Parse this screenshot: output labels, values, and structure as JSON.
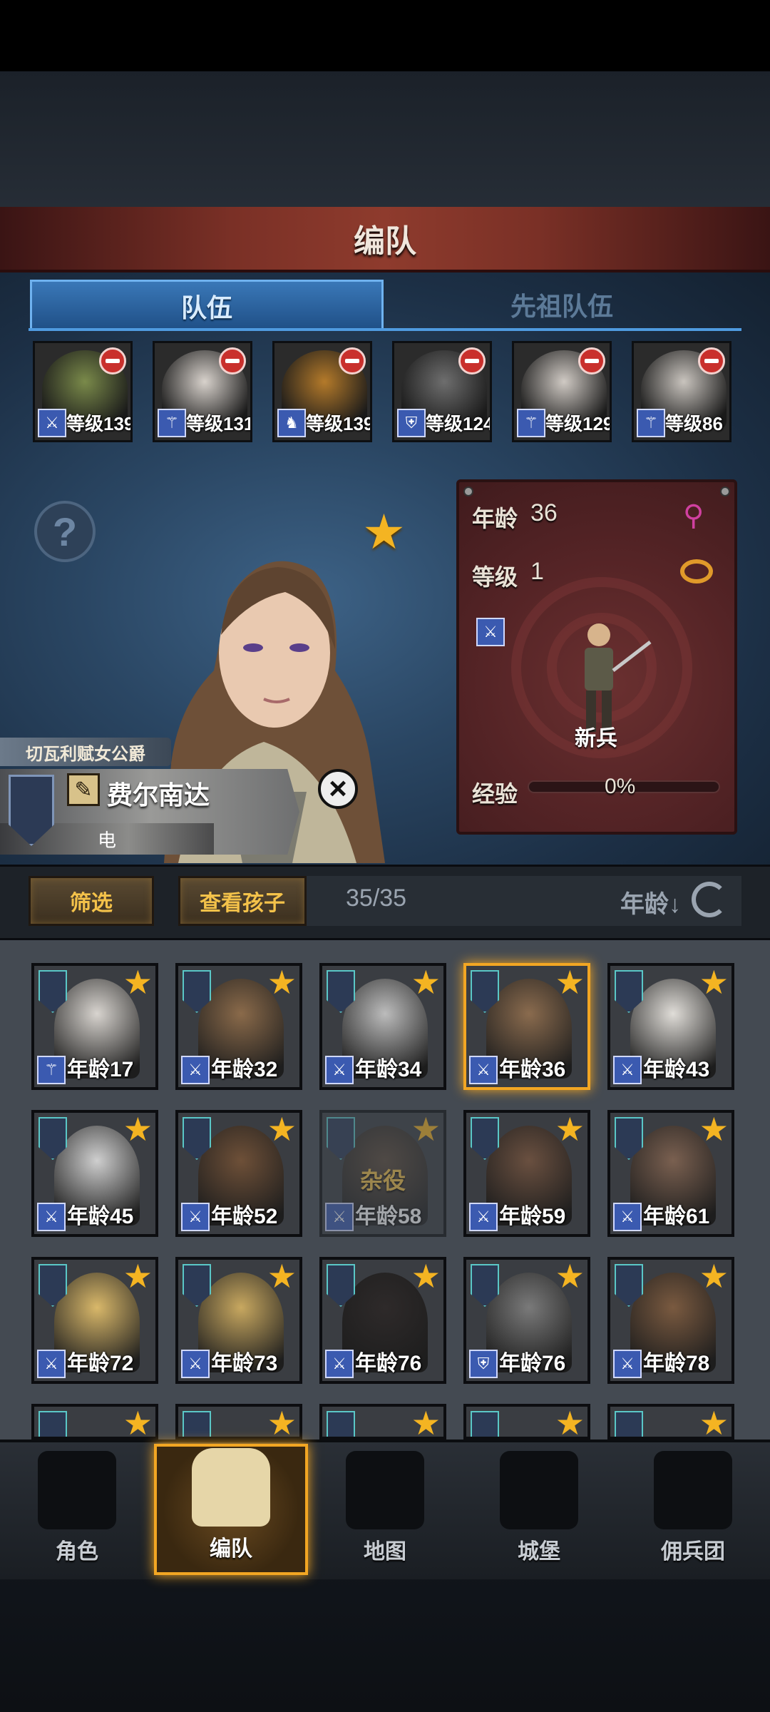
{
  "header": {
    "title": "编队"
  },
  "tabs": [
    {
      "label": "队伍",
      "active": true
    },
    {
      "label": "先祖队伍",
      "active": false
    }
  ],
  "team_slots": [
    {
      "level": "等级139",
      "class_icon": "sword-icon",
      "face": "#7a8a4a"
    },
    {
      "level": "等级131",
      "class_icon": "staff-icon",
      "face": "#d8d2cc"
    },
    {
      "level": "等级139",
      "class_icon": "horse-icon",
      "face": "#b47a2a"
    },
    {
      "level": "等级124",
      "class_icon": "shield-icon",
      "face": "#6e6e6e"
    },
    {
      "level": "等级129",
      "class_icon": "staff-icon",
      "face": "#d0cac4"
    },
    {
      "level": "等级86",
      "class_icon": "staff-icon",
      "face": "#c9c4be"
    }
  ],
  "selected": {
    "age_label": "年龄",
    "age": "36",
    "level_label": "等级",
    "level": "1",
    "unit": "新兵",
    "exp_label": "经验",
    "exp": "0%",
    "exp_fraction": 0,
    "title": "切瓦利赋女公爵",
    "name": "费尔南达",
    "element": "电",
    "gender_icon": "female-icon",
    "ring_icon": "ring-icon"
  },
  "toolbar": {
    "filter": "筛选",
    "children": "查看孩子",
    "count": "35/35",
    "sort": "年龄↓"
  },
  "roster": [
    {
      "age": "年龄17",
      "cls": "staff-icon",
      "face": "#d8d4cf"
    },
    {
      "age": "年龄32",
      "cls": "sword-icon",
      "face": "#8a6a4a"
    },
    {
      "age": "年龄34",
      "cls": "sword-icon",
      "face": "#bcbcbc"
    },
    {
      "age": "年龄36",
      "cls": "sword-icon",
      "face": "#8a6b4e",
      "selected": true
    },
    {
      "age": "年龄43",
      "cls": "sword-icon",
      "face": "#e0ddd8"
    },
    {
      "age": "年龄45",
      "cls": "sword-icon",
      "face": "#cfcfcf"
    },
    {
      "age": "年龄52",
      "cls": "sword-icon",
      "face": "#6e5038"
    },
    {
      "age": "年龄58",
      "cls": "sword-icon",
      "face": "#5a4a3a",
      "dim": true,
      "job": "杂役"
    },
    {
      "age": "年龄59",
      "cls": "sword-icon",
      "face": "#6a5040"
    },
    {
      "age": "年龄61",
      "cls": "sword-icon",
      "face": "#7a6050"
    },
    {
      "age": "年龄72",
      "cls": "sword-icon",
      "face": "#d9b86a"
    },
    {
      "age": "年龄73",
      "cls": "sword-icon",
      "face": "#c8a860"
    },
    {
      "age": "年龄76",
      "cls": "sword-icon",
      "face": "#2e2a2a"
    },
    {
      "age": "年龄76",
      "cls": "shield-icon",
      "face": "#7a7a7a"
    },
    {
      "age": "年龄78",
      "cls": "sword-icon",
      "face": "#7a5a40"
    }
  ],
  "nav": [
    {
      "label": "角色",
      "icon": "knight-icon",
      "active": false
    },
    {
      "label": "编队",
      "icon": "helmet-icon",
      "active": true
    },
    {
      "label": "地图",
      "icon": "map-compass-icon",
      "active": false
    },
    {
      "label": "城堡",
      "icon": "castle-icon",
      "active": false
    },
    {
      "label": "佣兵团",
      "icon": "mercenary-sword-icon",
      "active": false
    }
  ],
  "colors": {
    "accent": "#f2a623",
    "tab_active": "#3a78b8",
    "banner": "#8e3b2d",
    "card_panel": "#552426"
  }
}
